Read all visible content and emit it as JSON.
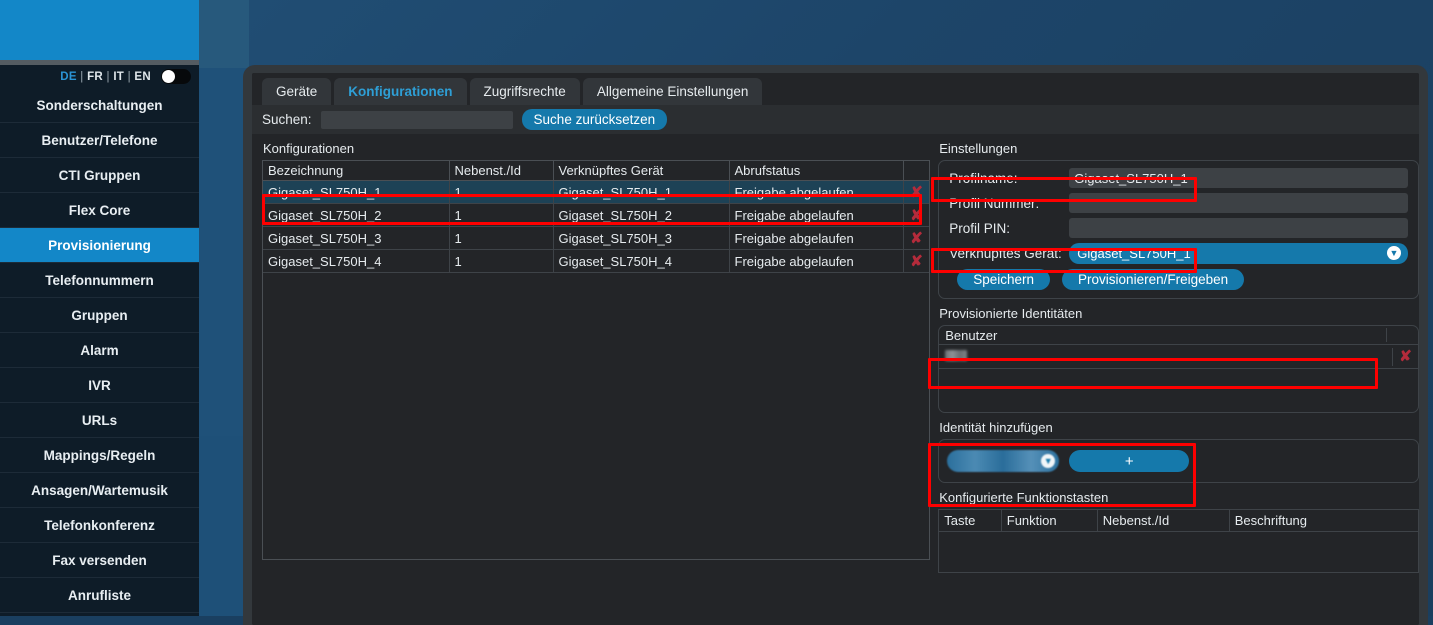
{
  "sidebar": {
    "languages": [
      "DE",
      "FR",
      "IT",
      "EN"
    ],
    "lang_selected": "DE",
    "lang_separator": "|",
    "items": [
      {
        "label": "Sonderschaltungen",
        "active": false
      },
      {
        "label": "Benutzer/Telefone",
        "active": false
      },
      {
        "label": "CTI Gruppen",
        "active": false
      },
      {
        "label": "Flex Core",
        "active": false
      },
      {
        "label": "Provisionierung",
        "active": true
      },
      {
        "label": "Telefonnummern",
        "active": false
      },
      {
        "label": "Gruppen",
        "active": false
      },
      {
        "label": "Alarm",
        "active": false
      },
      {
        "label": "IVR",
        "active": false
      },
      {
        "label": "URLs",
        "active": false
      },
      {
        "label": "Mappings/Regeln",
        "active": false
      },
      {
        "label": "Ansagen/Wartemusik",
        "active": false
      },
      {
        "label": "Telefonkonferenz",
        "active": false
      },
      {
        "label": "Fax versenden",
        "active": false
      },
      {
        "label": "Anrufliste",
        "active": false
      }
    ]
  },
  "tabs": [
    {
      "label": "Geräte",
      "active": false
    },
    {
      "label": "Konfigurationen",
      "active": true
    },
    {
      "label": "Zugriffsrechte",
      "active": false
    },
    {
      "label": "Allgemeine Einstellungen",
      "active": false
    }
  ],
  "search": {
    "label": "Suchen:",
    "value": "",
    "placeholder": "",
    "reset_label": "Suche zurücksetzen"
  },
  "configurations": {
    "title": "Konfigurationen",
    "columns": [
      "Bezeichnung",
      "Nebenst./Id",
      "Verknüpftes Gerät",
      "Abrufstatus",
      ""
    ],
    "rows": [
      {
        "bezeichnung": "Gigaset_SL750H_1",
        "nebenst": "1",
        "geraet": "Gigaset_SL750H_1",
        "status": "Freigabe abgelaufen",
        "delete": "✘",
        "selected": true
      },
      {
        "bezeichnung": "Gigaset_SL750H_2",
        "nebenst": "1",
        "geraet": "Gigaset_SL750H_2",
        "status": "Freigabe abgelaufen",
        "delete": "✘",
        "selected": false
      },
      {
        "bezeichnung": "Gigaset_SL750H_3",
        "nebenst": "1",
        "geraet": "Gigaset_SL750H_3",
        "status": "Freigabe abgelaufen",
        "delete": "✘",
        "selected": false
      },
      {
        "bezeichnung": "Gigaset_SL750H_4",
        "nebenst": "1",
        "geraet": "Gigaset_SL750H_4",
        "status": "Freigabe abgelaufen",
        "delete": "✘",
        "selected": false
      }
    ]
  },
  "settings": {
    "title": "Einstellungen",
    "profilname_label": "Profilname:",
    "profilname_value": "Gigaset_SL750H_1",
    "profilnummer_label": "Profil Nummer:",
    "profilnummer_value": "",
    "profilpin_label": "Profil PIN:",
    "profilpin_value": "",
    "geraet_label": "Verknüpftes Gerät:",
    "geraet_value": "Gigaset_SL750H_1",
    "caret": "▼",
    "save_label": "Speichern",
    "provision_label": "Provisionieren/Freigeben"
  },
  "identities": {
    "title": "Provisionierte Identitäten",
    "column_user": "Benutzer",
    "rows": [
      {
        "user": "",
        "delete": "✘"
      }
    ]
  },
  "add_identity": {
    "title": "Identität hinzufügen",
    "select_value": "",
    "caret": "▼",
    "add_label": "+"
  },
  "function_keys": {
    "title": "Konfigurierte Funktionstasten",
    "columns": [
      "Taste",
      "Funktion",
      "Nebenst./Id",
      "Beschriftung"
    ],
    "rows": []
  },
  "colors": {
    "accent": "#1387c8",
    "button": "#1579ab",
    "tab_active": "#2e9fd6",
    "annotation": "#fe0000",
    "row_selected": "#1d4256",
    "delete_x": "#b42b3b"
  }
}
